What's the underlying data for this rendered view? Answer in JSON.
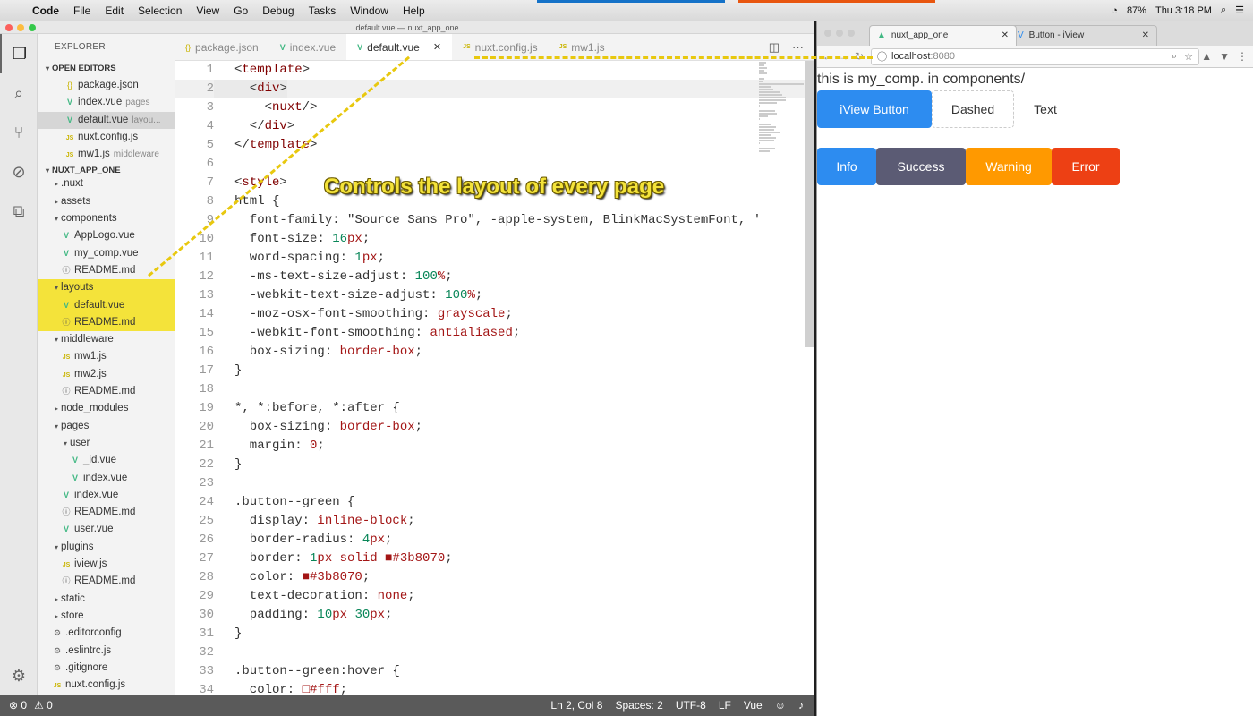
{
  "menubar": {
    "app": "Code",
    "items": [
      "File",
      "Edit",
      "Selection",
      "View",
      "Go",
      "Debug",
      "Tasks",
      "Window",
      "Help"
    ],
    "battery": "87%",
    "time": "Thu 3:18 PM"
  },
  "vscode": {
    "title": "default.vue — nuxt_app_one",
    "explorer": {
      "header": "EXPLORER",
      "open_editors_label": "OPEN EDITORS",
      "open_editors": [
        {
          "icon": "json-file-icon",
          "name": "package.json",
          "desc": ""
        },
        {
          "icon": "vue-file-icon",
          "name": "index.vue",
          "desc": "pages"
        },
        {
          "icon": "vue-file-icon",
          "name": "default.vue",
          "desc": "layou..."
        },
        {
          "icon": "js-file-icon",
          "name": "nuxt.config.js",
          "desc": ""
        },
        {
          "icon": "js-file-icon",
          "name": "mw1.js",
          "desc": "middleware"
        }
      ],
      "project_label": "NUXT_APP_ONE",
      "tree": [
        {
          "name": ".nuxt",
          "kind": "folder",
          "indent": 1,
          "open": false
        },
        {
          "name": "assets",
          "kind": "folder",
          "indent": 1,
          "open": false
        },
        {
          "name": "components",
          "kind": "folder",
          "indent": 1,
          "open": true
        },
        {
          "name": "AppLogo.vue",
          "kind": "vue",
          "indent": 2
        },
        {
          "name": "my_comp.vue",
          "kind": "vue",
          "indent": 2
        },
        {
          "name": "README.md",
          "kind": "info",
          "indent": 2
        },
        {
          "name": "layouts",
          "kind": "folder",
          "indent": 1,
          "open": true
        },
        {
          "name": "default.vue",
          "kind": "vue",
          "indent": 2
        },
        {
          "name": "README.md",
          "kind": "info",
          "indent": 2
        },
        {
          "name": "middleware",
          "kind": "folder",
          "indent": 1,
          "open": true
        },
        {
          "name": "mw1.js",
          "kind": "js",
          "indent": 2
        },
        {
          "name": "mw2.js",
          "kind": "js",
          "indent": 2
        },
        {
          "name": "README.md",
          "kind": "info",
          "indent": 2
        },
        {
          "name": "node_modules",
          "kind": "folder",
          "indent": 1,
          "open": false
        },
        {
          "name": "pages",
          "kind": "folder",
          "indent": 1,
          "open": true
        },
        {
          "name": "user",
          "kind": "folder",
          "indent": 2,
          "open": true
        },
        {
          "name": "_id.vue",
          "kind": "vue",
          "indent": 3
        },
        {
          "name": "index.vue",
          "kind": "vue",
          "indent": 3
        },
        {
          "name": "index.vue",
          "kind": "vue",
          "indent": 2
        },
        {
          "name": "README.md",
          "kind": "info",
          "indent": 2
        },
        {
          "name": "user.vue",
          "kind": "vue",
          "indent": 2
        },
        {
          "name": "plugins",
          "kind": "folder",
          "indent": 1,
          "open": true
        },
        {
          "name": "iview.js",
          "kind": "js",
          "indent": 2
        },
        {
          "name": "README.md",
          "kind": "info",
          "indent": 2
        },
        {
          "name": "static",
          "kind": "folder",
          "indent": 1,
          "open": false
        },
        {
          "name": "store",
          "kind": "folder",
          "indent": 1,
          "open": false
        },
        {
          "name": ".editorconfig",
          "kind": "cfg",
          "indent": 1
        },
        {
          "name": ".eslintrc.js",
          "kind": "cfg",
          "indent": 1
        },
        {
          "name": ".gitignore",
          "kind": "cfg",
          "indent": 1
        },
        {
          "name": "nuxt.config.js",
          "kind": "js",
          "indent": 1
        }
      ]
    },
    "tabs": [
      {
        "icon": "json-file-icon",
        "label": "package.json",
        "active": false
      },
      {
        "icon": "vue-file-icon",
        "label": "index.vue",
        "active": false
      },
      {
        "icon": "vue-file-icon",
        "label": "default.vue",
        "active": true
      },
      {
        "icon": "js-file-icon",
        "label": "nuxt.config.js",
        "active": false
      },
      {
        "icon": "js-file-icon",
        "label": "mw1.js",
        "active": false
      }
    ],
    "code_lines": [
      "<template>",
      "  <div>",
      "    <nuxt/>",
      "  </div>",
      "</template>",
      "",
      "<style>",
      "html {",
      "  font-family: \"Source Sans Pro\", -apple-system, BlinkMacSystemFont, '",
      "  font-size: 16px;",
      "  word-spacing: 1px;",
      "  -ms-text-size-adjust: 100%;",
      "  -webkit-text-size-adjust: 100%;",
      "  -moz-osx-font-smoothing: grayscale;",
      "  -webkit-font-smoothing: antialiased;",
      "  box-sizing: border-box;",
      "}",
      "",
      "*, *:before, *:after {",
      "  box-sizing: border-box;",
      "  margin: 0;",
      "}",
      "",
      ".button--green {",
      "  display: inline-block;",
      "  border-radius: 4px;",
      "  border: 1px solid ■#3b8070;",
      "  color: ■#3b8070;",
      "  text-decoration: none;",
      "  padding: 10px 30px;",
      "}",
      "",
      ".button--green:hover {",
      "  color: □#fff;"
    ],
    "current_line": 2,
    "annotation": "Controls the layout of every page",
    "status": {
      "errors": "0",
      "warnings": "0",
      "position": "Ln 2, Col 8",
      "spaces": "Spaces: 2",
      "encoding": "UTF-8",
      "eol": "LF",
      "language": "Vue"
    }
  },
  "browser": {
    "tabs": [
      {
        "label": "nuxt_app_one",
        "active": true
      },
      {
        "label": "Button - iView",
        "active": false
      }
    ],
    "url_host": "localhost",
    "url_port": ":8080",
    "page_text": "this is my_comp. in components/",
    "buttons_row1": [
      {
        "label": "iView Button",
        "style": "primary"
      },
      {
        "label": "Dashed",
        "style": "dashed"
      },
      {
        "label": "Text",
        "style": "text"
      }
    ],
    "buttons_row2": [
      {
        "label": "Info",
        "style": "info"
      },
      {
        "label": "Success",
        "style": "success"
      },
      {
        "label": "Warning",
        "style": "warning"
      },
      {
        "label": "Error",
        "style": "error"
      }
    ]
  },
  "colors": {
    "primary": "#2d8cf0",
    "info": "#2d8cf0",
    "success": "#5b5b74",
    "warning": "#ff9900",
    "error": "#ed4014",
    "highlight": "#f4e33a"
  }
}
